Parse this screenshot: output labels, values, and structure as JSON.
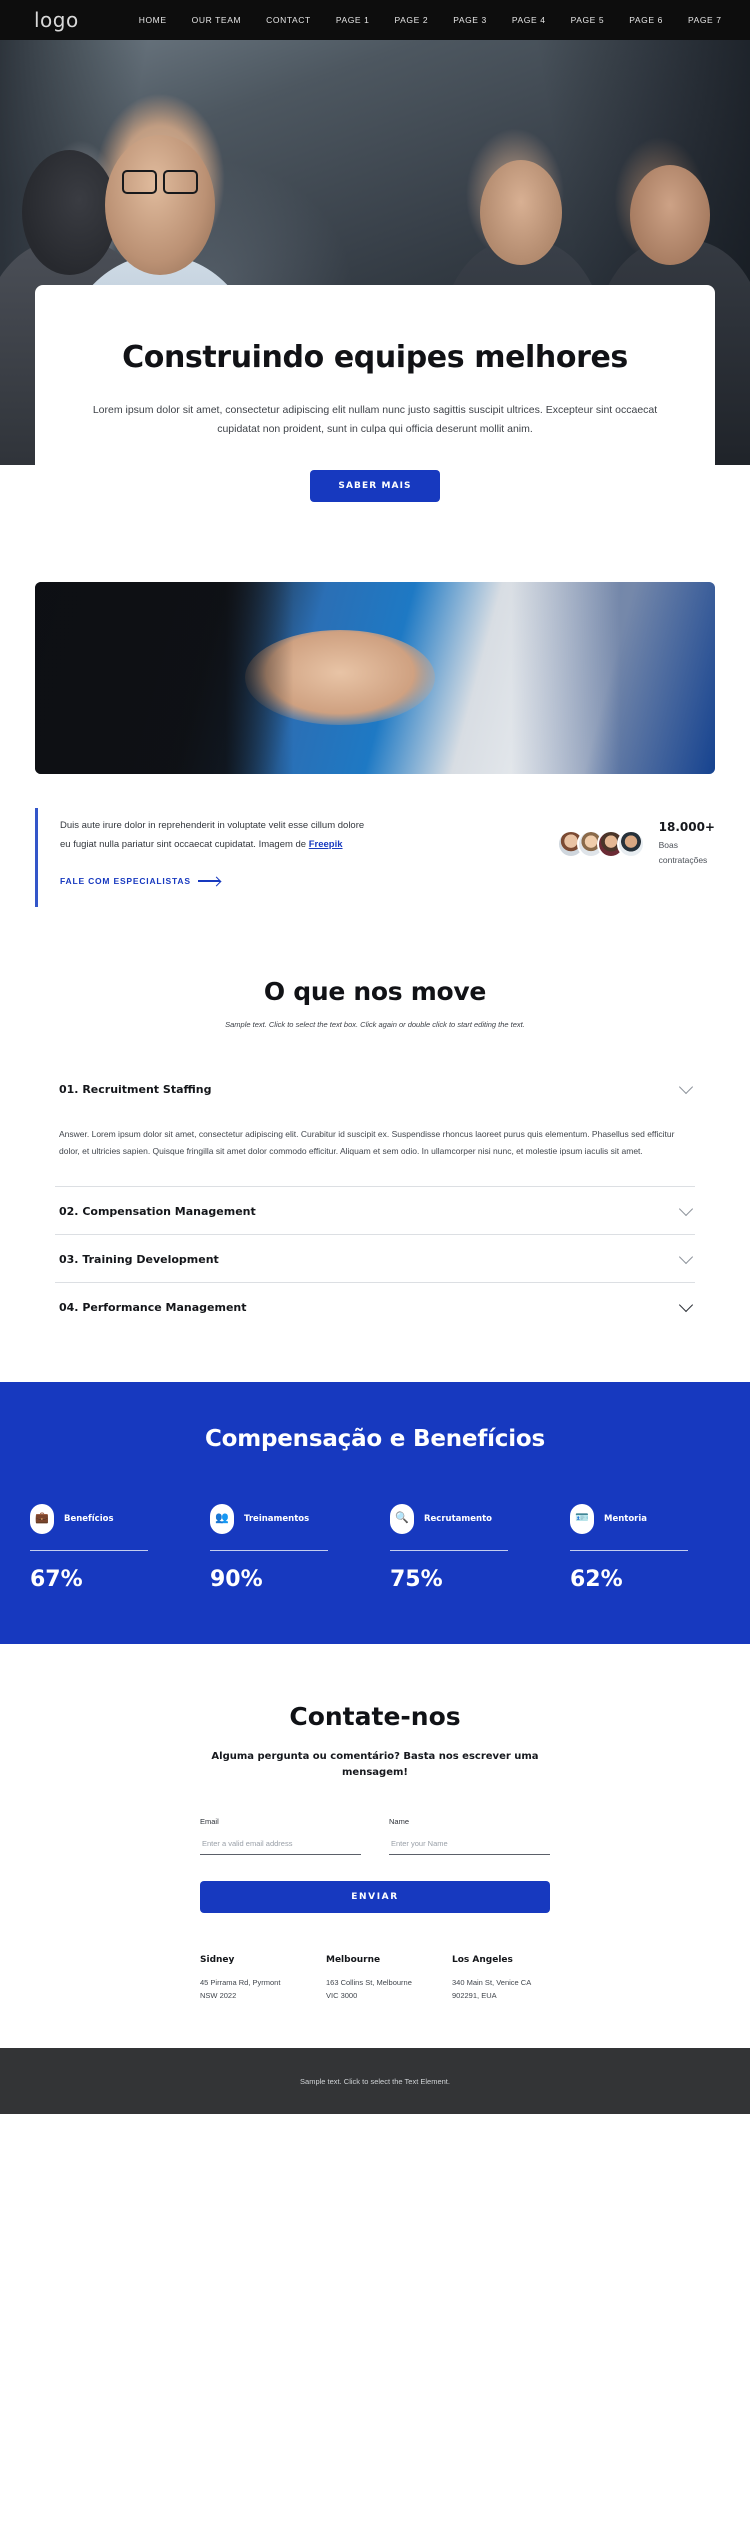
{
  "nav": {
    "logo": "logo",
    "links": [
      "HOME",
      "OUR TEAM",
      "CONTACT",
      "PAGE 1",
      "PAGE 2",
      "PAGE 3",
      "PAGE 4",
      "PAGE 5",
      "PAGE 6",
      "PAGE 7"
    ]
  },
  "hero": {
    "title": "Construindo equipes melhores",
    "paragraph": "Lorem ipsum dolor sit amet, consectetur adipiscing elit nullam nunc justo sagittis suscipit ultrices. Excepteur sint occaecat cupidatat non proident, sunt in culpa qui officia deserunt mollit anim.",
    "cta": "SABER MAIS"
  },
  "quote": {
    "text_before": "Duis aute irure dolor in reprehenderit in voluptate velit esse cillum dolore eu fugiat nulla pariatur sint occaecat cupidatat. Imagem de ",
    "link": "Freepik",
    "cta": "FALE COM ESPECIALISTAS"
  },
  "stat": {
    "number": "18.000+",
    "label_line1": "Boas",
    "label_line2": "contratações"
  },
  "about": {
    "title": "O que nos move",
    "note": "Sample text. Click to select the text box. Click again or double click to start editing the text.",
    "items": [
      {
        "title": "01. Recruitment Staffing",
        "body": "Answer. Lorem ipsum dolor sit amet, consectetur adipiscing elit. Curabitur id suscipit ex. Suspendisse rhoncus laoreet purus quis elementum. Phasellus sed efficitur dolor, et ultricies sapien. Quisque fringilla sit amet dolor commodo efficitur. Aliquam et sem odio. In ullamcorper nisi nunc, et molestie ipsum iaculis sit amet.",
        "open": true
      },
      {
        "title": "02. Compensation Management",
        "body": "",
        "open": false
      },
      {
        "title": "03. Training Development",
        "body": "",
        "open": false
      },
      {
        "title": "04. Performance Management",
        "body": "",
        "open": false
      }
    ]
  },
  "benefits": {
    "title": "Compensação e Benefícios",
    "accent": "#1739bf",
    "metrics": [
      {
        "icon": "briefcase-icon",
        "glyph": "💼",
        "label": "Benefícios",
        "value": "67%"
      },
      {
        "icon": "people-group-icon",
        "glyph": "👥",
        "label": "Treinamentos",
        "value": "90%"
      },
      {
        "icon": "magnifier-person-icon",
        "glyph": "🔍",
        "label": "Recrutamento",
        "value": "75%"
      },
      {
        "icon": "id-card-icon",
        "glyph": "🪪",
        "label": "Mentoria",
        "value": "62%"
      }
    ]
  },
  "contact": {
    "title": "Contate-nos",
    "subtitle": "Alguma pergunta ou comentário? Basta nos escrever uma mensagem!",
    "email_label": "Email",
    "email_placeholder": "Enter a valid email address",
    "email_value": "",
    "name_label": "Name",
    "name_placeholder": "Enter your Name",
    "name_value": "",
    "submit": "ENVIAR"
  },
  "offices": [
    {
      "city": "Sidney",
      "address": "45 Pirrama Rd, Pyrmont NSW 2022"
    },
    {
      "city": "Melbourne",
      "address": "163 Collins St, Melbourne VIC 3000"
    },
    {
      "city": "Los Angeles",
      "address": "340 Main St, Venice CA 902291, EUA"
    }
  ],
  "footer": {
    "text": "Sample text. Click to select the Text Element."
  }
}
